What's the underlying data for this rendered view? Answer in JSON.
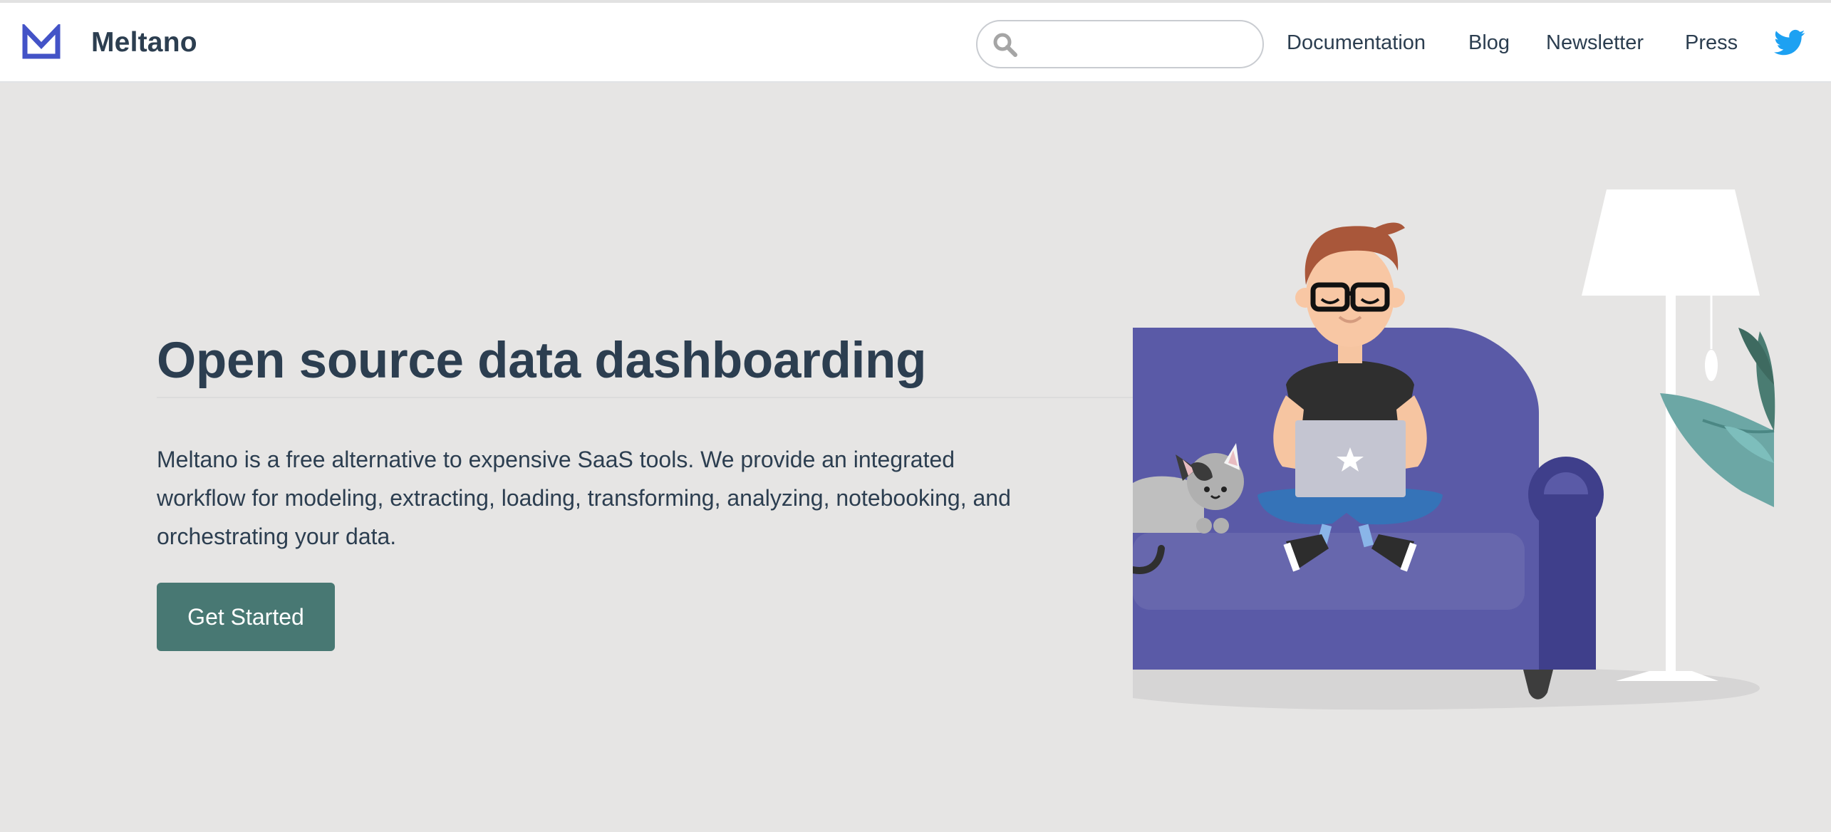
{
  "nav": {
    "brand": "Meltano",
    "search_placeholder": "",
    "links": [
      {
        "label": "Documentation"
      },
      {
        "label": "Blog"
      },
      {
        "label": "Newsletter"
      },
      {
        "label": "Press"
      }
    ],
    "icons": {
      "logo": "meltano-logo-icon",
      "search": "search-icon",
      "social": "twitter-icon"
    }
  },
  "hero": {
    "title": "Open source data dashboarding",
    "description": "Meltano is a free alternative to expensive SaaS tools. We provide an integrated workflow for modeling, extracting, loading, transforming, analyzing, notebooking, and orchestrating your data.",
    "cta_label": "Get Started"
  },
  "colors": {
    "brand": "#4353c7",
    "text": "#2c3e50",
    "background": "#e6e5e4",
    "cta": "#487873",
    "twitter": "#1da1f2"
  }
}
